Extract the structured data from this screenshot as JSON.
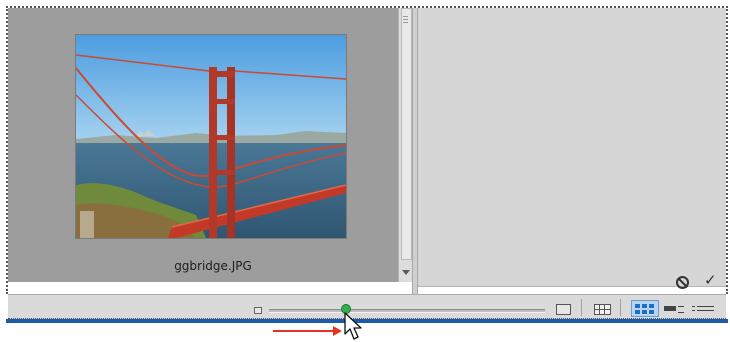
{
  "grid": {
    "items": [
      {
        "filename": "ggbridge.JPG"
      }
    ]
  },
  "right_panel": {
    "actions": [
      {
        "icon": "cancel-icon"
      },
      {
        "icon": "checkmark-icon",
        "glyph": "✓"
      }
    ]
  },
  "bottom_bar": {
    "thumbnail_size": {
      "min_icon": "small-thumbnail-icon",
      "max_icon": "large-thumbnail-icon",
      "value_fraction": 0.27
    },
    "view_modes": [
      {
        "name": "grid-view",
        "selected": false
      },
      {
        "name": "thumbnail-view",
        "selected": true
      },
      {
        "name": "detail-view",
        "selected": false
      },
      {
        "name": "list-view",
        "selected": false
      }
    ]
  },
  "colors": {
    "grid_background": "#9d9d9d",
    "panel_background": "#d6d6d6",
    "accent_band": "#1b5caa",
    "slider_knob": "#2faf52",
    "annotation_arrow": "#e53322"
  }
}
